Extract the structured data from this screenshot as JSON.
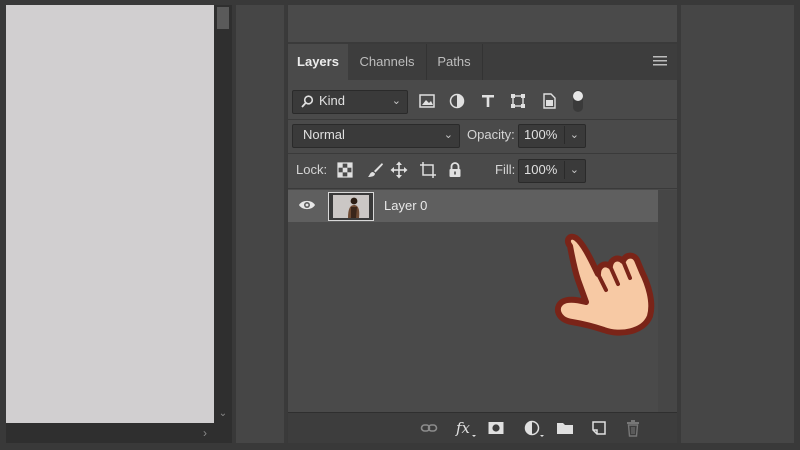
{
  "tabs": [
    {
      "label": "Layers",
      "active": true
    },
    {
      "label": "Channels",
      "active": false
    },
    {
      "label": "Paths",
      "active": false
    }
  ],
  "filter": {
    "kind_label": "Kind",
    "icons": [
      "image-filter-icon",
      "adjustment-filter-icon",
      "type-filter-icon",
      "shape-filter-icon",
      "smart-object-filter-icon",
      "filter-toggle-icon"
    ]
  },
  "blend": {
    "mode": "Normal",
    "opacity_label": "Opacity:",
    "opacity_value": "100%"
  },
  "lock": {
    "label": "Lock:",
    "icons": [
      "lock-transparent-pixels-icon",
      "lock-image-pixels-icon",
      "lock-position-icon",
      "lock-artboard-icon",
      "lock-all-icon"
    ],
    "fill_label": "Fill:",
    "fill_value": "100%"
  },
  "layers": [
    {
      "name": "Layer 0",
      "visible": true,
      "selected": true
    }
  ],
  "bottom_icons": [
    "link-layers-icon",
    "layer-style-icon",
    "add-mask-icon",
    "new-fill-adjustment-icon",
    "new-group-icon",
    "new-layer-icon",
    "delete-layer-icon"
  ],
  "colors": {
    "panel_bg": "#4a4a4a",
    "selected_row": "#5f5f5f",
    "canvas": "#d1cfd0",
    "hand_skin": "#f7c9a4",
    "hand_outline": "#7a2418"
  }
}
